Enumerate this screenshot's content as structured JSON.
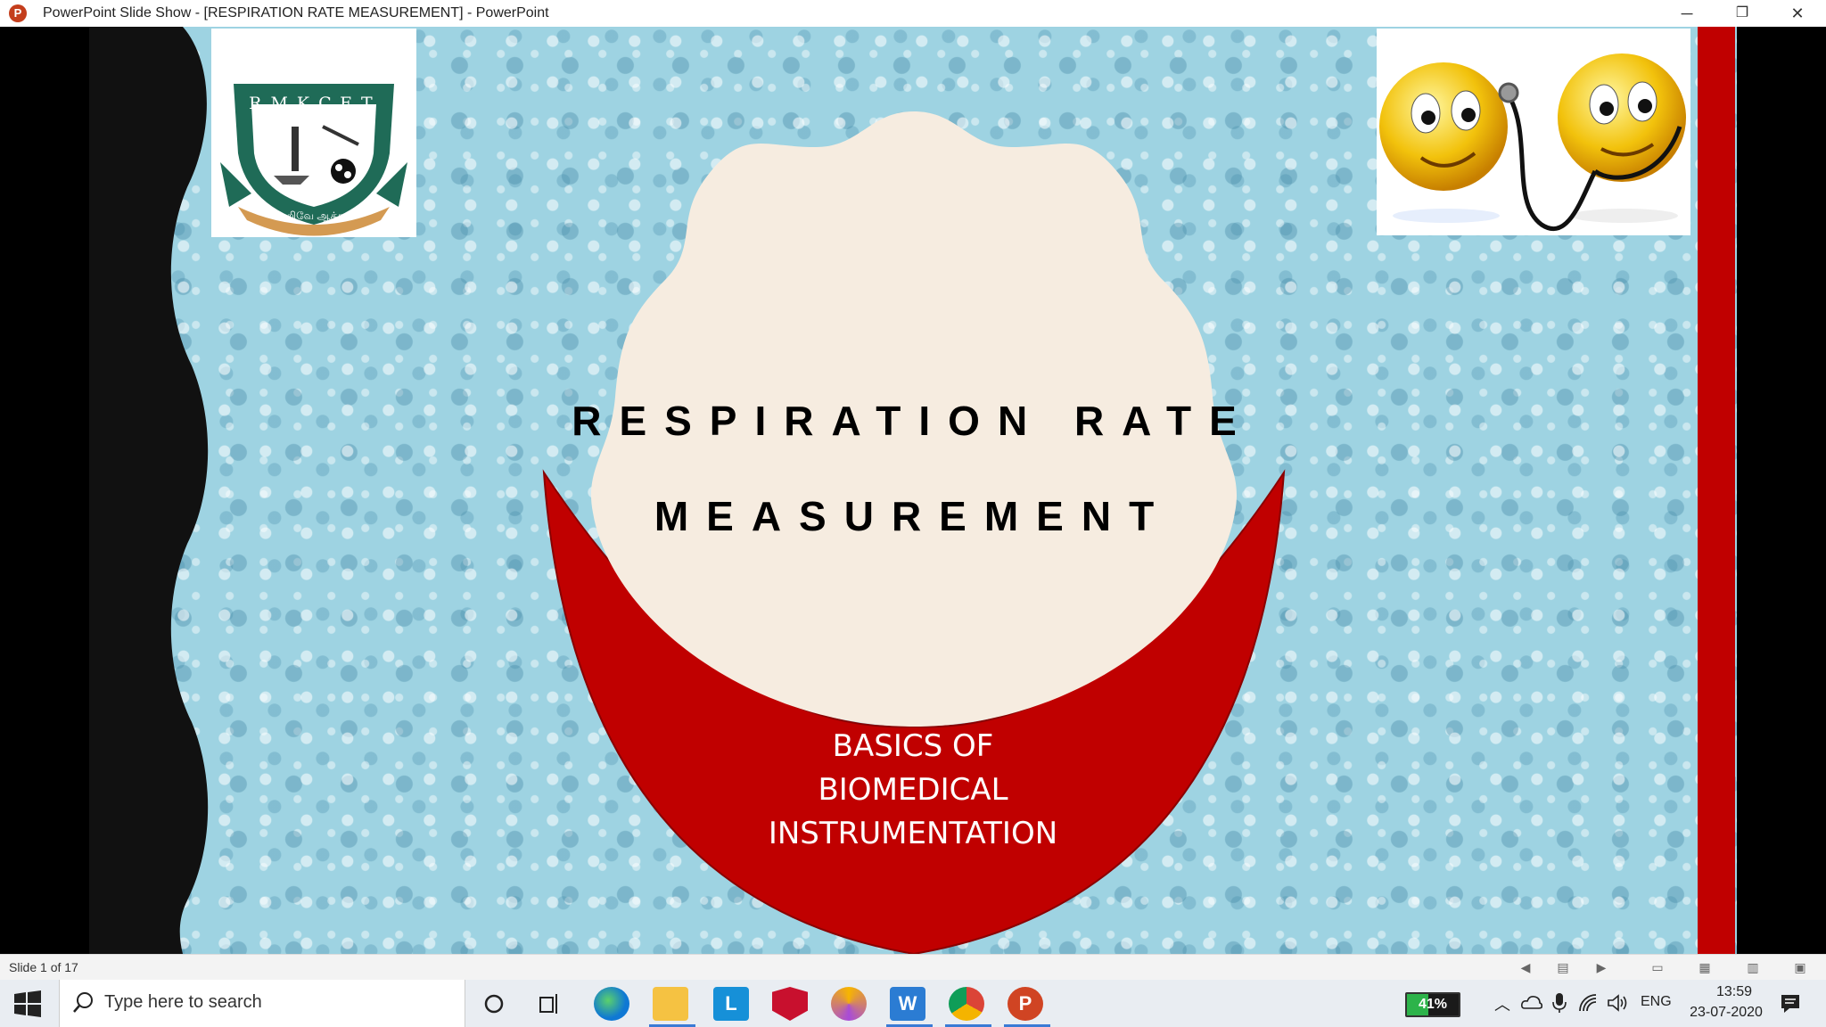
{
  "window": {
    "title": "PowerPoint Slide Show - [RESPIRATION RATE MEASUREMENT] - PowerPoint",
    "app_icon_letter": "P",
    "controls": {
      "minimize": "─",
      "restore": "❐",
      "close": "✕"
    }
  },
  "slide": {
    "logo": {
      "text": "R.M.K.C.E.T.",
      "motto": "அறிவே ஆக்கம்"
    },
    "title_line1": "RESPIRATION RATE",
    "title_line2": "MEASUREMENT",
    "subtitle_lines": [
      "BASICS OF",
      "BIOMEDICAL",
      "INSTRUMENTATION"
    ],
    "colors": {
      "accent_red": "#c00000",
      "cream": "#f6ece0",
      "water": "#9ed3e2"
    }
  },
  "statusbar": {
    "slide_count": "Slide 1 of 17",
    "icons": [
      "previous-icon",
      "notes-icon",
      "next-icon",
      "normal-view-icon",
      "slide-sorter-icon",
      "reading-view-icon",
      "slideshow-icon"
    ]
  },
  "taskbar": {
    "search_placeholder": "Type here to search",
    "apps": [
      "cortana-icon",
      "task-view-icon",
      "edge-icon",
      "file-explorer-icon",
      "l-app-icon",
      "mcafee-icon",
      "chrome-canary-icon",
      "word-app-icon",
      "chrome-icon",
      "powerpoint-icon"
    ],
    "battery_percent": "41%",
    "battery_level": 0.41,
    "language": "ENG",
    "time": "13:59",
    "date": "23-07-2020"
  }
}
